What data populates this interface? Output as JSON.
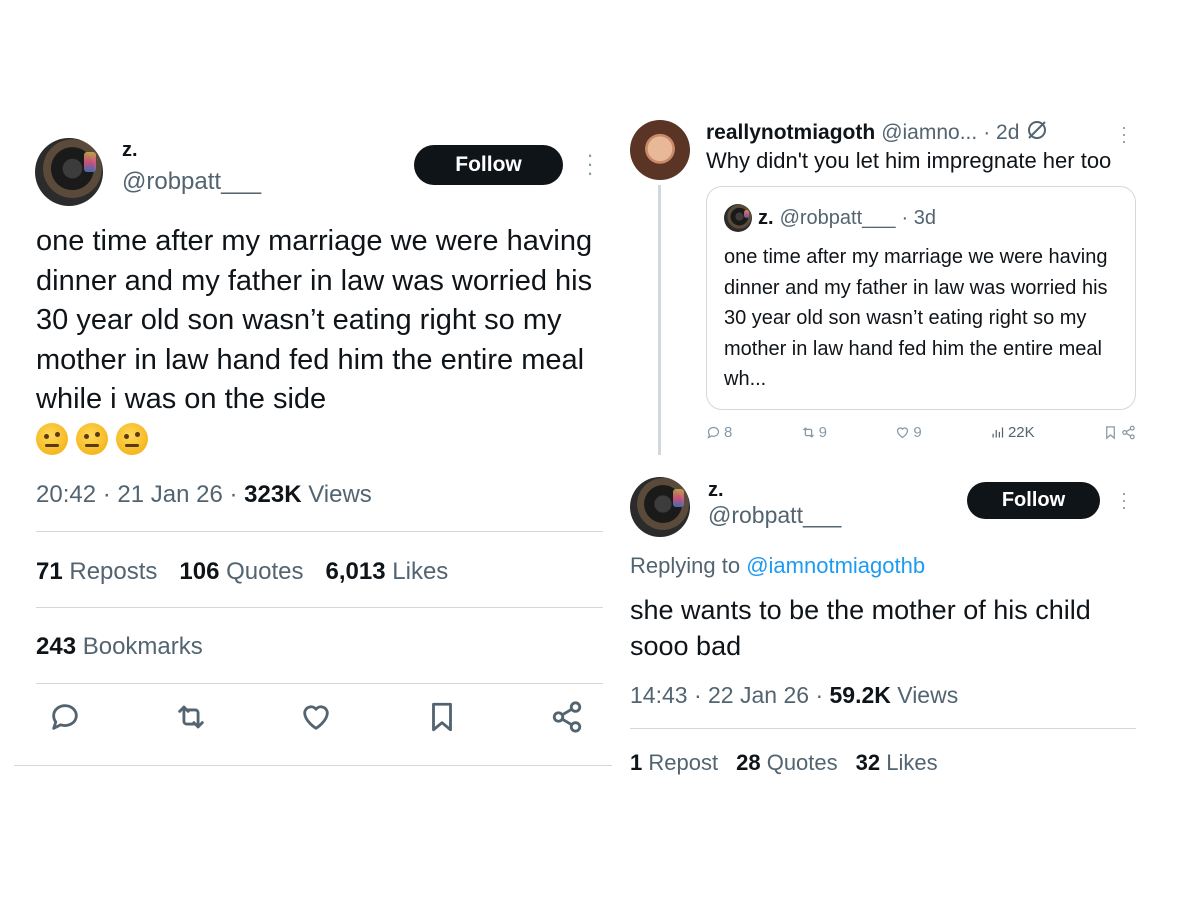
{
  "left_tweet": {
    "author_name": "z.",
    "author_handle": "@robpatt___",
    "follow_label": "Follow",
    "text": "one time after my marriage we were having dinner and my father in law was worried his 30 year old son wasn’t eating right so my mother in law hand fed him the entire meal while i was on the side",
    "emoji_name": "face-with-raised-eyebrow-emoji",
    "emoji_count": 3,
    "time": "20:42",
    "date": "21 Jan 26",
    "views_count": "323K",
    "views_label": "Views",
    "reposts_count": "71",
    "reposts_label": "Reposts",
    "quotes_count": "106",
    "quotes_label": "Quotes",
    "likes_count": "6,013",
    "likes_label": "Likes",
    "bookmarks_count": "243",
    "bookmarks_label": "Bookmarks",
    "actions": [
      "reply-icon",
      "repost-icon",
      "like-icon",
      "bookmark-icon",
      "share-icon"
    ]
  },
  "right_thread": {
    "quote_tweet": {
      "author_name": "reallynotmiagoth",
      "author_handle": "@iamno...",
      "age": "· 2d",
      "text": "Why didn't you let him impregnate her too",
      "quoted": {
        "author_name": "z.",
        "author_handle": "@robpatt___",
        "age": "· 3d",
        "text": "one time after my marriage we were having dinner and my father in law was worried his 30 year old son wasn’t eating right so my mother in law hand fed him the entire meal wh..."
      },
      "replies": "8",
      "reposts": "9",
      "likes": "9",
      "views": "22K"
    },
    "reply": {
      "author_name": "z.",
      "author_handle": "@robpatt___",
      "follow_label": "Follow",
      "replying_to_label": "Replying to",
      "replying_to_handle": "@iamnotmiagothb",
      "text": "she wants to be the mother of his child sooo bad",
      "time": "14:43",
      "date": "22 Jan 26",
      "views_count": "59.2K",
      "views_label": "Views",
      "reposts_count": "1",
      "reposts_label": "Repost",
      "quotes_count": "28",
      "quotes_label": "Quotes",
      "likes_count": "32",
      "likes_label": "Likes"
    }
  },
  "colors": {
    "text": "#0f1419",
    "secondary": "#536471",
    "link": "#1d9bf0",
    "border": "#cfd9de"
  }
}
